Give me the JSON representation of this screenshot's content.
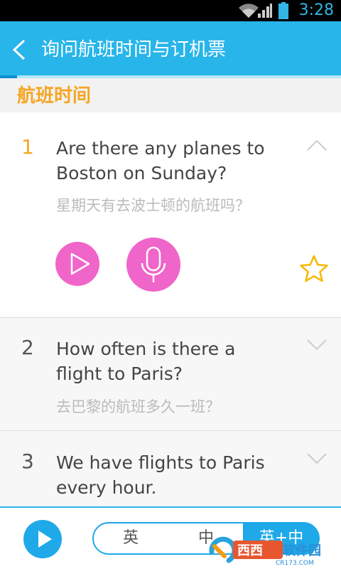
{
  "status_bar": {
    "time": "3:28"
  },
  "header": {
    "title": "询问航班时间与订机票"
  },
  "progress": {
    "fraction": 0.05
  },
  "section": {
    "title": "航班时间"
  },
  "items": [
    {
      "number": "1",
      "english": "Are there any planes to Boston on Sunday?",
      "chinese": "星期天有去波士顿的航班吗？",
      "expanded": true
    },
    {
      "number": "2",
      "english": "How often is there a flight to Paris?",
      "chinese": "去巴黎的航班多久一班？",
      "expanded": false
    },
    {
      "number": "3",
      "english": "We have flights to Paris every hour.",
      "chinese": "",
      "expanded": false
    }
  ],
  "bottom": {
    "modes": [
      "英",
      "中",
      "英+中"
    ],
    "selected_mode": "英+中"
  },
  "watermark": {
    "text": "西西软件园",
    "subtext": "CR173.COM"
  },
  "colors": {
    "accent": "#27b5ea",
    "number_active": "#f5a623",
    "pink": "#f065c9",
    "star": "#f5b800"
  },
  "icons": [
    "wifi-icon",
    "signal-icon",
    "battery-icon",
    "back-arrow-icon",
    "chevron-up-icon",
    "chevron-down-icon",
    "play-icon",
    "microphone-icon",
    "star-icon"
  ]
}
